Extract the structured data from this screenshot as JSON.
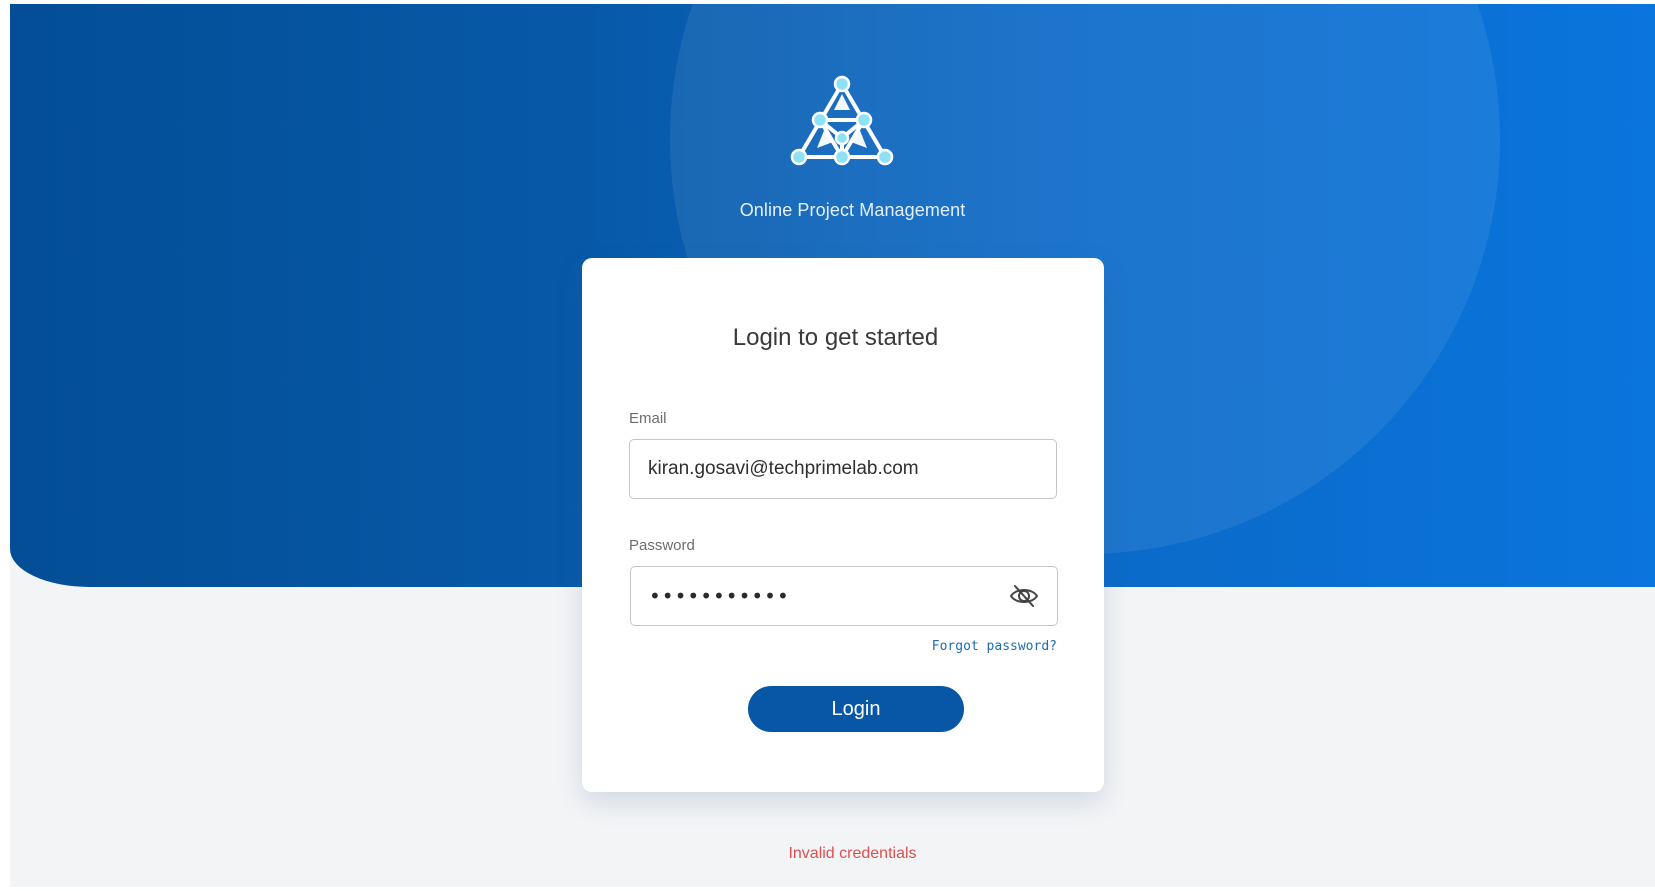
{
  "brand": {
    "name": "Online Project Management"
  },
  "login_card": {
    "title": "Login to get started",
    "email_label": "Email",
    "email_value": "kiran.gosavi@techprimelab.com",
    "password_label": "Password",
    "password_mask": "•••••••••••",
    "forgot_password_label": "Forgot password?",
    "login_button_label": "Login"
  },
  "status": {
    "error_message": "Invalid credentials"
  },
  "colors": {
    "primary": "#0757a6",
    "hero_dark": "#034e96",
    "hero_light": "#0a75dd",
    "error": "#e04f4f",
    "link": "#1f6bb8",
    "background": "#f3f4f6"
  },
  "icons": {
    "logo": "network-triangle-logo",
    "password_toggle": "eye-slash-icon"
  }
}
